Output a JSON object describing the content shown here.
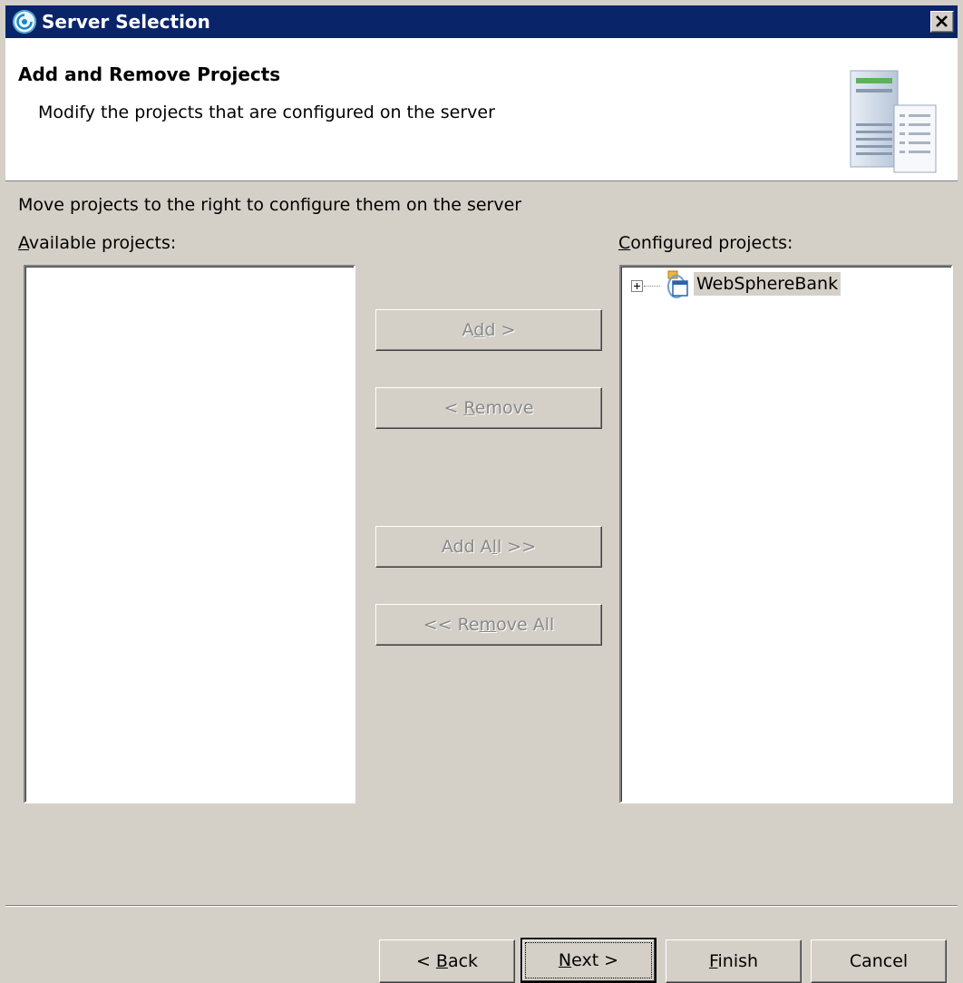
{
  "window": {
    "title": "Server Selection",
    "app_icon": "websphere-swirl-icon",
    "close_icon": "close-icon"
  },
  "banner": {
    "heading": "Add and Remove Projects",
    "description": "Modify the projects that are configured on the server",
    "graphic": "server-config-icon"
  },
  "instruction": "Move projects to the right to configure them on the server",
  "available": {
    "label_mnemonic": "A",
    "label_rest": "vailable projects:",
    "items": []
  },
  "configured": {
    "label_mnemonic": "C",
    "label_rest": "onfigured projects:",
    "items": [
      {
        "label": "WebSphereBank",
        "icon": "enterprise-app-icon",
        "expanded": false,
        "selected": true
      }
    ]
  },
  "move_buttons": {
    "add": {
      "pre": "A",
      "mn": "d",
      "post": "d >"
    },
    "remove": {
      "pre": "< ",
      "mn": "R",
      "post": "emove"
    },
    "add_all": {
      "pre": "Add A",
      "mn": "l",
      "post": "l >>"
    },
    "remove_all": {
      "pre": "<< Re",
      "mn": "m",
      "post": "ove All"
    }
  },
  "nav_buttons": {
    "back": {
      "pre": "< ",
      "mn": "B",
      "post": "ack"
    },
    "next": {
      "pre": "",
      "mn": "N",
      "post": "ext >"
    },
    "finish": {
      "pre": "",
      "mn": "F",
      "post": "inish"
    },
    "cancel": {
      "label": "Cancel"
    }
  },
  "colors": {
    "titlebar": "#0a246a",
    "dialog": "#d4d0c8",
    "selection": "#d4d0c8"
  }
}
